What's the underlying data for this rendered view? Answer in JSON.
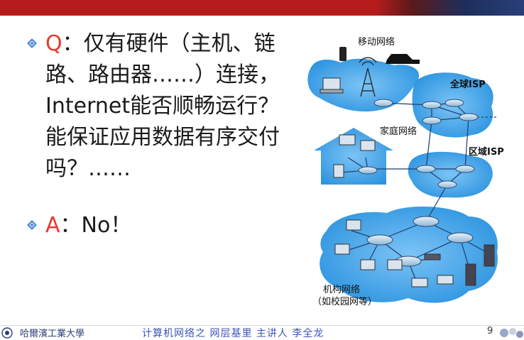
{
  "slide": {
    "q_label": "Q",
    "q_text": "：仅有硬件（主机、链路、路由器……）连接，Internet能否顺畅运行？能保证应用数据有序交付吗？……",
    "a_label": "A",
    "a_text": "：No！"
  },
  "diagram": {
    "mobile_network": "移动网络",
    "global_isp": "全球ISP",
    "home_network": "家庭网络",
    "regional_isp": "区域ISP",
    "institution_network": "机构网络",
    "institution_note": "（如校园网等）"
  },
  "footer": {
    "university": "哈爾濱工業大學",
    "course": "计算机网络之 网层基里 主讲人 李全龙",
    "page_number": "9"
  },
  "colors": {
    "accent_red": "#e8392b",
    "topbar": "#b71c1c",
    "cloud_blue": "#3aa0e6",
    "course_blue": "#3b57b5"
  }
}
